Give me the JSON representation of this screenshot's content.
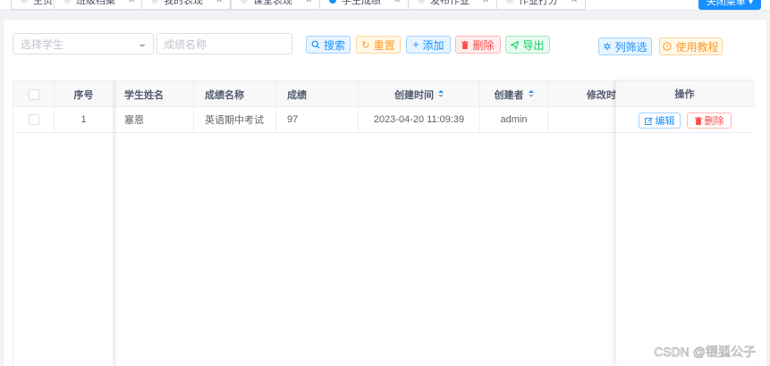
{
  "tags": [
    {
      "label": "主页",
      "active": false
    },
    {
      "label": "班级档案",
      "active": false
    },
    {
      "label": "我的表现",
      "active": false
    },
    {
      "label": "课堂表现",
      "active": false
    },
    {
      "label": "学生成绩",
      "active": true
    },
    {
      "label": "发布作业",
      "active": false
    },
    {
      "label": "作业打分",
      "active": false
    }
  ],
  "close_menu": {
    "label": "关闭菜单",
    "icon": "caret-down-icon"
  },
  "filters": {
    "student_select_placeholder": "选择学生",
    "score_name_placeholder": "成绩名称"
  },
  "toolbar": {
    "search": "搜索",
    "reset": "重置",
    "add": "添加",
    "delete": "删除",
    "export": "导出",
    "column_filter": "列筛选",
    "tutorial": "使用教程"
  },
  "table": {
    "columns": {
      "index": "序号",
      "student_name": "学生姓名",
      "score_name": "成绩名称",
      "score": "成绩",
      "created_time": "创建时间",
      "creator": "创建者",
      "modified_time": "修改时",
      "actions": "操作"
    },
    "rows": [
      {
        "index": "1",
        "student_name": "塞恩",
        "score_name": "英语期中考试",
        "score": "97",
        "created_time": "2023-04-20 11:09:39",
        "creator": "admin",
        "modified_time": "",
        "edit": "编辑",
        "delete": "删除"
      }
    ]
  },
  "watermark": "CSDN @银狐公子",
  "colors": {
    "primary": "#1890ff",
    "warning": "#ff9a2e",
    "danger": "#ff4949",
    "success": "#13ce66"
  }
}
